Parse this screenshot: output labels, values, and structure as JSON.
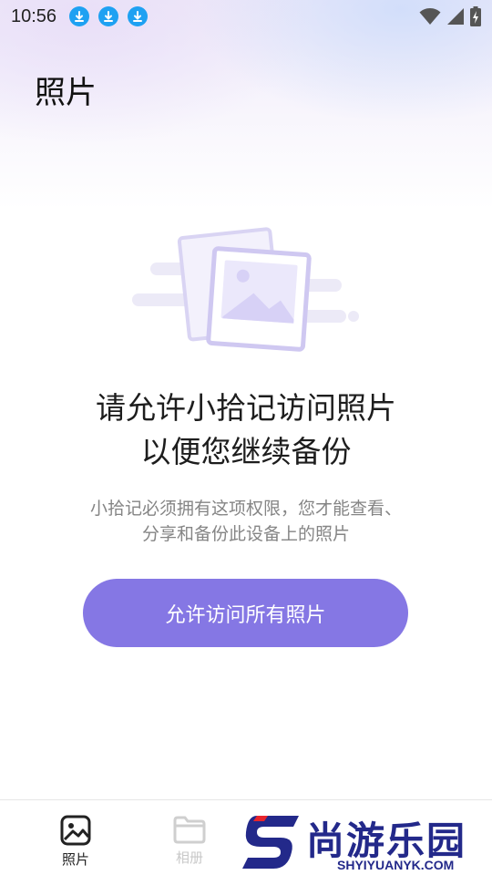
{
  "status_bar": {
    "time": "10:56",
    "download_icons": [
      "download-icon",
      "download-icon",
      "download-icon"
    ],
    "right_icons": [
      "wifi-icon",
      "signal-icon",
      "battery-charging-icon"
    ]
  },
  "page": {
    "title": "照片"
  },
  "permission": {
    "headline_line1": "请允许小拾记访问照片",
    "headline_line2": "以便您继续备份",
    "desc_line1": "小拾记必须拥有这项权限，您才能查看、",
    "desc_line2": "分享和备份此设备上的照片",
    "allow_button": "允许访问所有照片"
  },
  "bottom_nav": {
    "items": [
      {
        "label": "照片",
        "icon": "image-icon",
        "active": true
      },
      {
        "label": "相册",
        "icon": "folder-icon",
        "active": false
      }
    ]
  },
  "watermark": {
    "name_cn": "尚游乐园",
    "name_en": "SHYIYUANYK.COM"
  },
  "colors": {
    "accent": "#8577e4",
    "download_badge": "#1ea1f2",
    "watermark_blue": "#23298a",
    "watermark_red": "#e8242c"
  }
}
